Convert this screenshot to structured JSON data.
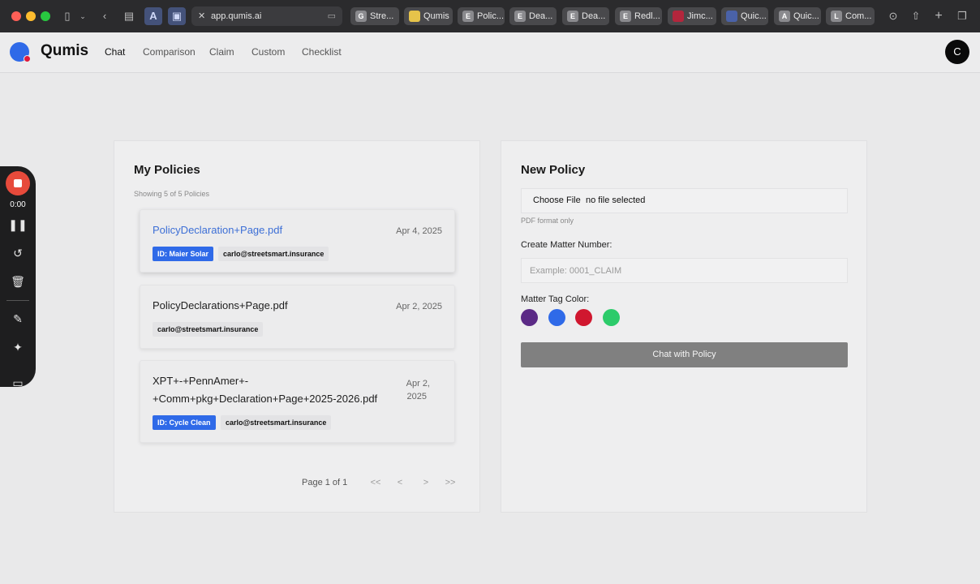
{
  "browser": {
    "address": "app.qumis.ai",
    "tabs": [
      {
        "label": "Stre...",
        "fav": "G"
      },
      {
        "label": "Qumis",
        "fav": ""
      },
      {
        "label": "Polic...",
        "fav": "E"
      },
      {
        "label": "Dea...",
        "fav": "E"
      },
      {
        "label": "Dea...",
        "fav": "E"
      },
      {
        "label": "Redl...",
        "fav": "E"
      },
      {
        "label": "Jimc...",
        "fav": ""
      },
      {
        "label": "Quic...",
        "fav": ""
      },
      {
        "label": "Quic...",
        "fav": "A"
      },
      {
        "label": "Com...",
        "fav": "L"
      }
    ]
  },
  "header": {
    "brand": "Qumis",
    "nav": [
      "Chat",
      "Comparison",
      "Claim",
      "Custom",
      "Checklist"
    ],
    "avatar_initial": "C"
  },
  "recorder": {
    "time": "0:00"
  },
  "policies": {
    "title": "My Policies",
    "showing": "Showing 5 of 5 Policies",
    "items": [
      {
        "name": "PolicyDeclaration+Page.pdf",
        "date": "Apr 4, 2025",
        "id_badge": "ID: Maier Solar",
        "email": "carlo@streetsmart.insurance"
      },
      {
        "name": "PolicyDeclarations+Page.pdf",
        "date": "Apr 2, 2025",
        "email": "carlo@streetsmart.insurance"
      },
      {
        "name_line1": "XPT+-+PennAmer+-",
        "name_line2": "+Comm+pkg+Declaration+Page+2025-2026.pdf",
        "date_line1": "Apr 2,",
        "date_line2": "2025",
        "id_badge": "ID: Cycle Clean",
        "email": "carlo@streetsmart.insurance"
      }
    ],
    "pager": {
      "text": "Page 1 of 1",
      "first": "<<",
      "prev": "<",
      "next": ">",
      "last": ">>"
    }
  },
  "new_policy": {
    "title": "New Policy",
    "choose_file": "Choose File",
    "file_status": "no file selected",
    "file_hint": "PDF format only",
    "matter_label": "Create Matter Number:",
    "matter_placeholder": "Example: 0001_CLAIM",
    "color_label": "Matter Tag Color:",
    "colors": [
      "#5b2a86",
      "#2f6ae8",
      "#d0172f",
      "#2ccb6a"
    ],
    "submit": "Chat with Policy"
  }
}
